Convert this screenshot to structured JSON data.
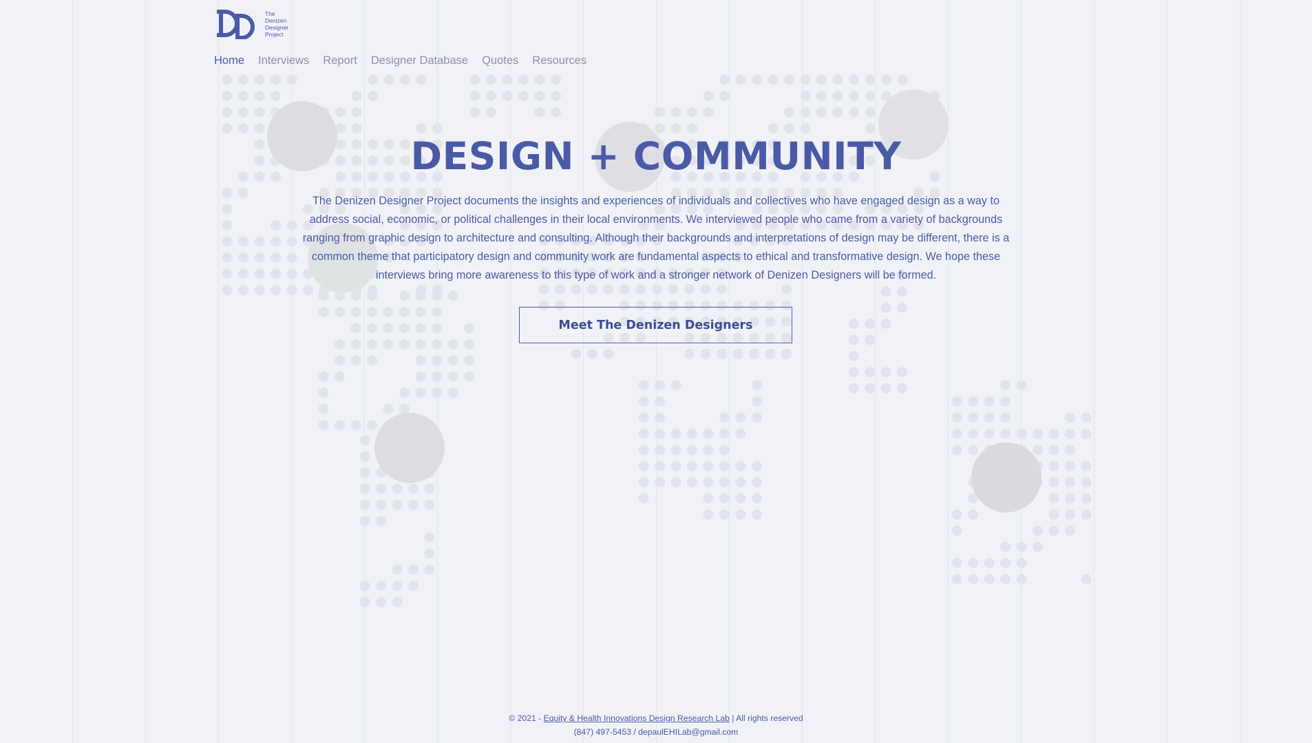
{
  "logo": {
    "lines": [
      "The",
      "Denizen",
      "Designer",
      "Project"
    ],
    "icon": "dd-monogram-logo"
  },
  "nav": {
    "items": [
      {
        "label": "Home",
        "active": true
      },
      {
        "label": "Interviews"
      },
      {
        "label": "Report"
      },
      {
        "label": "Designer Database"
      },
      {
        "label": "Quotes"
      },
      {
        "label": "Resources"
      }
    ]
  },
  "hero": {
    "title": "DESIGN + COMMUNITY",
    "description": "The Denizen Designer Project documents the insights and experiences of individuals and collectives who have engaged design as a way to address social, economic, or political challenges in their local environments. We interviewed people who came from a variety of backgrounds ranging from graphic design to architecture and consulting. Although their backgrounds and interpretations of design may be different, there is a common theme that participatory design and community work are fundamental aspects to ethical and transformative design. We hope these interviews bring more awareness to this type of work and a stronger network of Denizen Designers will be formed.",
    "cta_label": "Meet The Denizen Designers"
  },
  "background": {
    "map_icon": "dotted-world-map",
    "portrait_icon": "designer-portrait-avatar"
  },
  "footer": {
    "copyright_prefix": "© 2021 - ",
    "lab_link": "Equity & Health Innovations Design Research Lab",
    "rights": " | All rights reserved",
    "contact": "(847) 497-5453 / depaulEHILab@gmail.com"
  },
  "colors": {
    "accent": "#4a5aa6",
    "background": "#f1f2f7",
    "nav_inactive": "#8a93ad"
  }
}
